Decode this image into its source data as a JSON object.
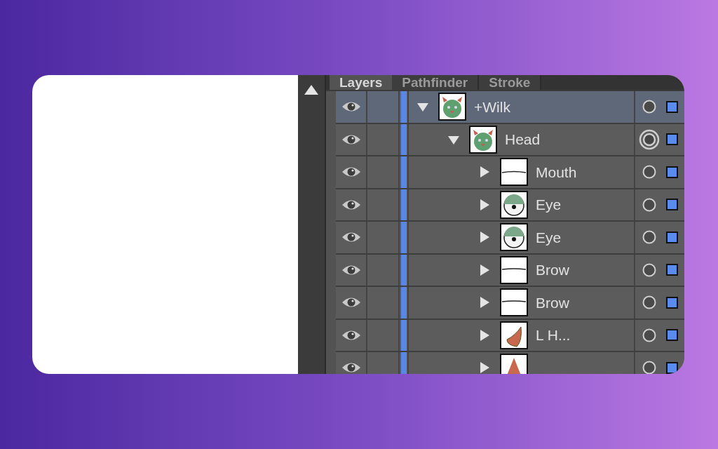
{
  "tabs": [
    {
      "label": "Layers",
      "selected": true
    },
    {
      "label": "Pathfinder",
      "selected": false
    },
    {
      "label": "Stroke",
      "selected": false
    }
  ],
  "layers": [
    {
      "name": "+Wilk",
      "kind": "face",
      "expanded": true,
      "selected": true,
      "targeted": false,
      "visible": true,
      "children": [
        {
          "name": "Head",
          "kind": "face",
          "expanded": true,
          "selected": false,
          "targeted": true,
          "visible": true,
          "children": [
            {
              "name": "Mouth",
              "kind": "mouth",
              "expanded": false,
              "selected": false,
              "targeted": false,
              "visible": true
            },
            {
              "name": "Eye",
              "kind": "eye",
              "expanded": false,
              "selected": false,
              "targeted": false,
              "visible": true
            },
            {
              "name": "Eye",
              "kind": "eye",
              "expanded": false,
              "selected": false,
              "targeted": false,
              "visible": true
            },
            {
              "name": "Brow",
              "kind": "brow",
              "expanded": false,
              "selected": false,
              "targeted": false,
              "visible": true
            },
            {
              "name": "Brow",
              "kind": "brow",
              "expanded": false,
              "selected": false,
              "targeted": false,
              "visible": true
            },
            {
              "name": "L H...",
              "kind": "horn",
              "expanded": false,
              "selected": false,
              "targeted": false,
              "visible": true
            },
            {
              "kind": "nose",
              "expanded": false,
              "selected": false,
              "targeted": false,
              "visible": true
            }
          ]
        }
      ]
    }
  ]
}
